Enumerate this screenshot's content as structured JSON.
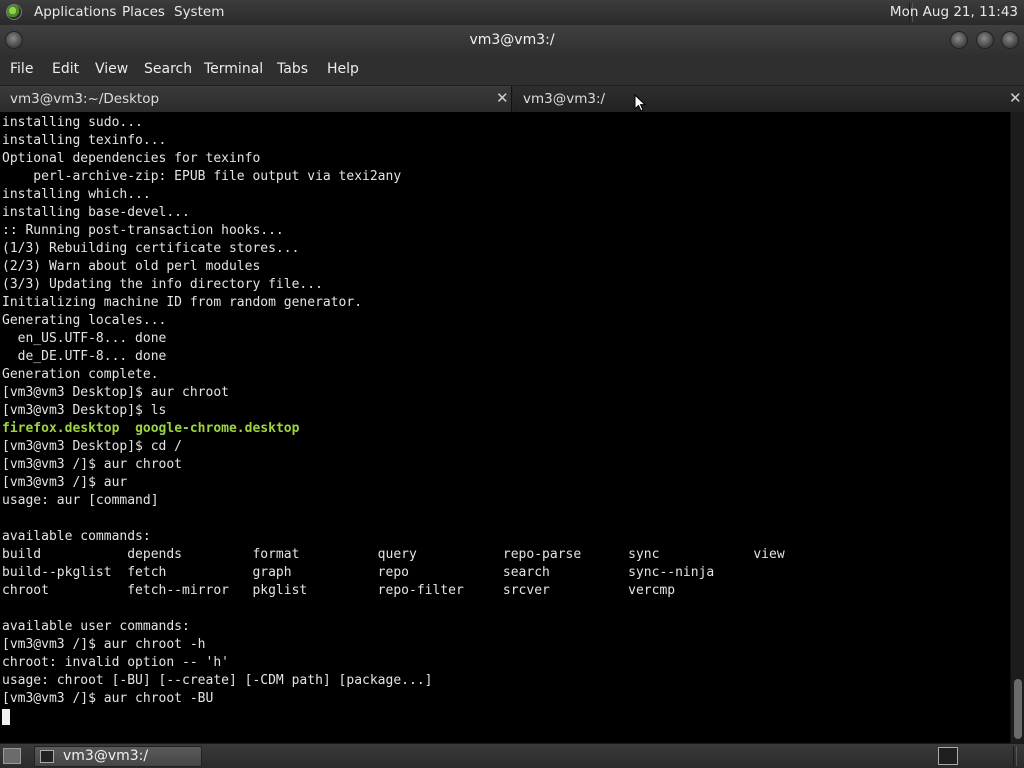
{
  "top_panel": {
    "menus": [
      "Applications",
      "Places",
      "System"
    ],
    "clock": "Mon Aug 21, 11:43"
  },
  "window": {
    "title": "vm3@vm3:/"
  },
  "menubar": [
    "File",
    "Edit",
    "View",
    "Search",
    "Terminal",
    "Tabs",
    "Help"
  ],
  "tabs": [
    {
      "label": "vm3@vm3:~/Desktop",
      "active": false
    },
    {
      "label": "vm3@vm3:/",
      "active": true
    }
  ],
  "terminal": {
    "lines": [
      {
        "text": "installing sudo..."
      },
      {
        "text": "installing texinfo..."
      },
      {
        "text": "Optional dependencies for texinfo"
      },
      {
        "text": "    perl-archive-zip: EPUB file output via texi2any"
      },
      {
        "text": "installing which..."
      },
      {
        "text": "installing base-devel..."
      },
      {
        "text": ":: Running post-transaction hooks..."
      },
      {
        "text": "(1/3) Rebuilding certificate stores..."
      },
      {
        "text": "(2/3) Warn about old perl modules"
      },
      {
        "text": "(3/3) Updating the info directory file..."
      },
      {
        "text": "Initializing machine ID from random generator."
      },
      {
        "text": "Generating locales..."
      },
      {
        "text": "  en_US.UTF-8... done"
      },
      {
        "text": "  de_DE.UTF-8... done"
      },
      {
        "text": "Generation complete."
      },
      {
        "text": "[vm3@vm3 Desktop]$ aur chroot"
      },
      {
        "text": "[vm3@vm3 Desktop]$ ls"
      },
      {
        "segments": [
          {
            "text": "firefox.desktop",
            "color": "green"
          },
          {
            "text": "  "
          },
          {
            "text": "google-chrome.desktop",
            "color": "green"
          }
        ]
      },
      {
        "text": "[vm3@vm3 Desktop]$ cd /"
      },
      {
        "text": "[vm3@vm3 /]$ aur chroot"
      },
      {
        "text": "[vm3@vm3 /]$ aur"
      },
      {
        "text": "usage: aur [command]"
      },
      {
        "text": ""
      },
      {
        "text": "available commands:"
      },
      {
        "text": "build           depends         format          query           repo-parse      sync            view"
      },
      {
        "text": "build--pkglist  fetch           graph           repo            search          sync--ninja"
      },
      {
        "text": "chroot          fetch--mirror   pkglist         repo-filter     srcver          vercmp"
      },
      {
        "text": ""
      },
      {
        "text": "available user commands:"
      },
      {
        "text": "[vm3@vm3 /]$ aur chroot -h"
      },
      {
        "text": "chroot: invalid option -- 'h'"
      },
      {
        "text": "usage: chroot [-BU] [--create] [-CDM path] [package...]"
      },
      {
        "text": "[vm3@vm3 /]$ aur chroot -BU"
      }
    ]
  },
  "taskbar": {
    "task_label": "vm3@vm3:/"
  },
  "colors": {
    "terminal_bg": "#000000",
    "terminal_fg": "#e4e4e4",
    "ls_highlight": "#9cd442",
    "panel_bg": "#2f2f2f"
  },
  "icons": {
    "panel_logo": "mate-logo-icon",
    "tab_close": "close-icon",
    "taskbar_task": "terminal-icon",
    "tray": "terminal-icon"
  }
}
